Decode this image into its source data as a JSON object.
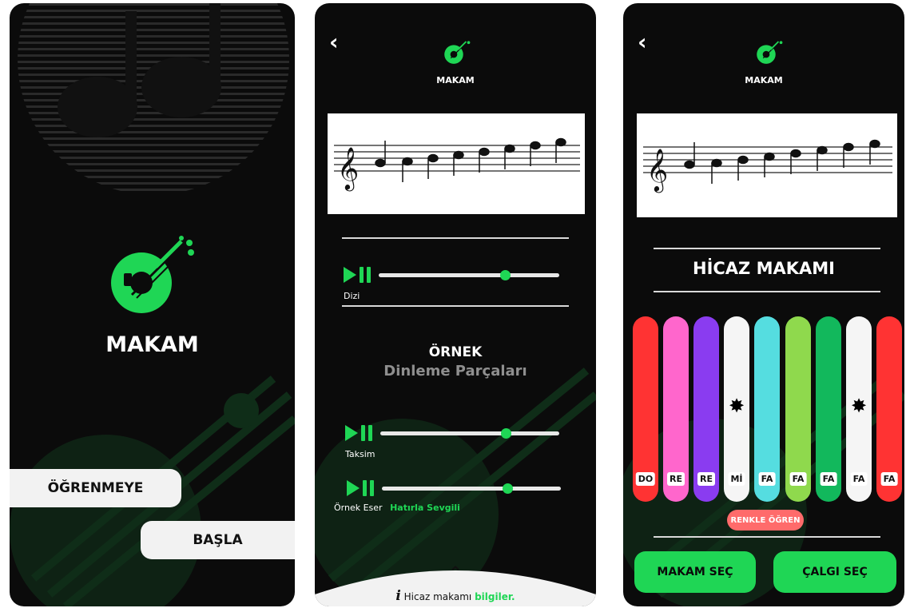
{
  "colors": {
    "accent": "#1fd655",
    "background": "#0b0b0b",
    "pink_button": "#ff6b6b"
  },
  "screen1": {
    "title": "MAKAM",
    "learn_label": "ÖĞRENMEYE",
    "start_label": "BAŞLA"
  },
  "screen2": {
    "header": "MAKAM",
    "back_icon": "chevron-left-icon",
    "players": [
      {
        "label": "Dizi",
        "progress": 0.7
      },
      {
        "label": "Taksim",
        "progress": 0.7
      },
      {
        "label": "Örnek Eser",
        "link": "Hatırla Sevgili",
        "progress": 0.7
      }
    ],
    "section_title": "ÖRNEK",
    "section_subtitle": "Dinleme Parçaları",
    "info_prefix": "Hicaz makamı",
    "info_link": "bilgiler."
  },
  "screen3": {
    "header": "MAKAM",
    "makam_title": "HİCAZ MAKAMI",
    "bars": [
      {
        "note": "DO",
        "color": "#ff3333",
        "star": false
      },
      {
        "note": "RE",
        "color": "#ff66cc",
        "star": false
      },
      {
        "note": "RE",
        "color": "#8a3cf0",
        "star": false
      },
      {
        "note": "Mİ",
        "color": "#f5f5f5",
        "star": true
      },
      {
        "note": "FA",
        "color": "#55dde0",
        "star": false
      },
      {
        "note": "FA",
        "color": "#8fd94d",
        "star": false
      },
      {
        "note": "FA",
        "color": "#12b85c",
        "star": false
      },
      {
        "note": "FA",
        "color": "#f5f5f5",
        "star": true
      },
      {
        "note": "FA",
        "color": "#ff3333",
        "star": false
      }
    ],
    "color_learn_label": "RENKLE ÖĞREN",
    "select_makam_label": "MAKAM SEÇ",
    "select_instrument_label": "ÇALGI SEÇ"
  }
}
